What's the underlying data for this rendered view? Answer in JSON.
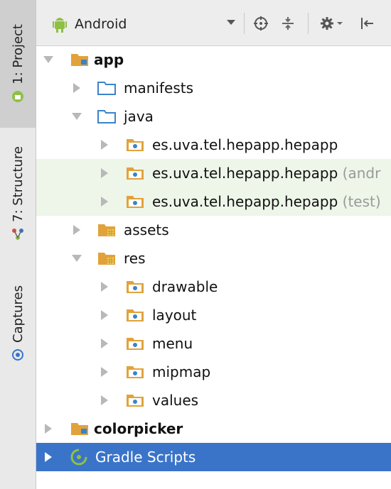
{
  "side_tabs": [
    {
      "label": "1: Project",
      "icon": "android-icon"
    },
    {
      "label": "7: Structure",
      "icon": "structure-icon"
    },
    {
      "label": "Captures",
      "icon": "captures-icon"
    }
  ],
  "toolbar": {
    "view_selector": "Android",
    "buttons": [
      "target-icon",
      "collapse-icon",
      "gear-icon",
      "pin-icon"
    ]
  },
  "tree": [
    {
      "label": "app",
      "bold": true,
      "expanded": true,
      "icon": "module-folder-icon"
    },
    {
      "label": "manifests",
      "expanded": false,
      "icon": "folder-icon"
    },
    {
      "label": "java",
      "expanded": true,
      "icon": "folder-icon"
    },
    {
      "label": "es.uva.tel.hepapp.hepapp",
      "suffix": "",
      "expanded": false,
      "icon": "package-icon"
    },
    {
      "label": "es.uva.tel.hepapp.hepapp",
      "suffix": "(andr",
      "expanded": false,
      "icon": "package-icon"
    },
    {
      "label": "es.uva.tel.hepapp.hepapp",
      "suffix": "(test)",
      "expanded": false,
      "icon": "package-icon"
    },
    {
      "label": "assets",
      "expanded": false,
      "icon": "resource-folder-icon"
    },
    {
      "label": "res",
      "expanded": true,
      "icon": "resource-folder-icon"
    },
    {
      "label": "drawable",
      "expanded": false,
      "icon": "package-icon"
    },
    {
      "label": "layout",
      "expanded": false,
      "icon": "package-icon"
    },
    {
      "label": "menu",
      "expanded": false,
      "icon": "package-icon"
    },
    {
      "label": "mipmap",
      "expanded": false,
      "icon": "package-icon"
    },
    {
      "label": "values",
      "expanded": false,
      "icon": "package-icon"
    },
    {
      "label": "colorpicker",
      "bold": true,
      "expanded": false,
      "icon": "module-folder-icon"
    },
    {
      "label": "Gradle Scripts",
      "expanded": false,
      "selected": true,
      "icon": "gradle-icon"
    }
  ],
  "colors": {
    "selection": "#3a74c9",
    "highlight": "#eef5e9",
    "folder": "#3b83c9",
    "android": "#8fc045"
  }
}
